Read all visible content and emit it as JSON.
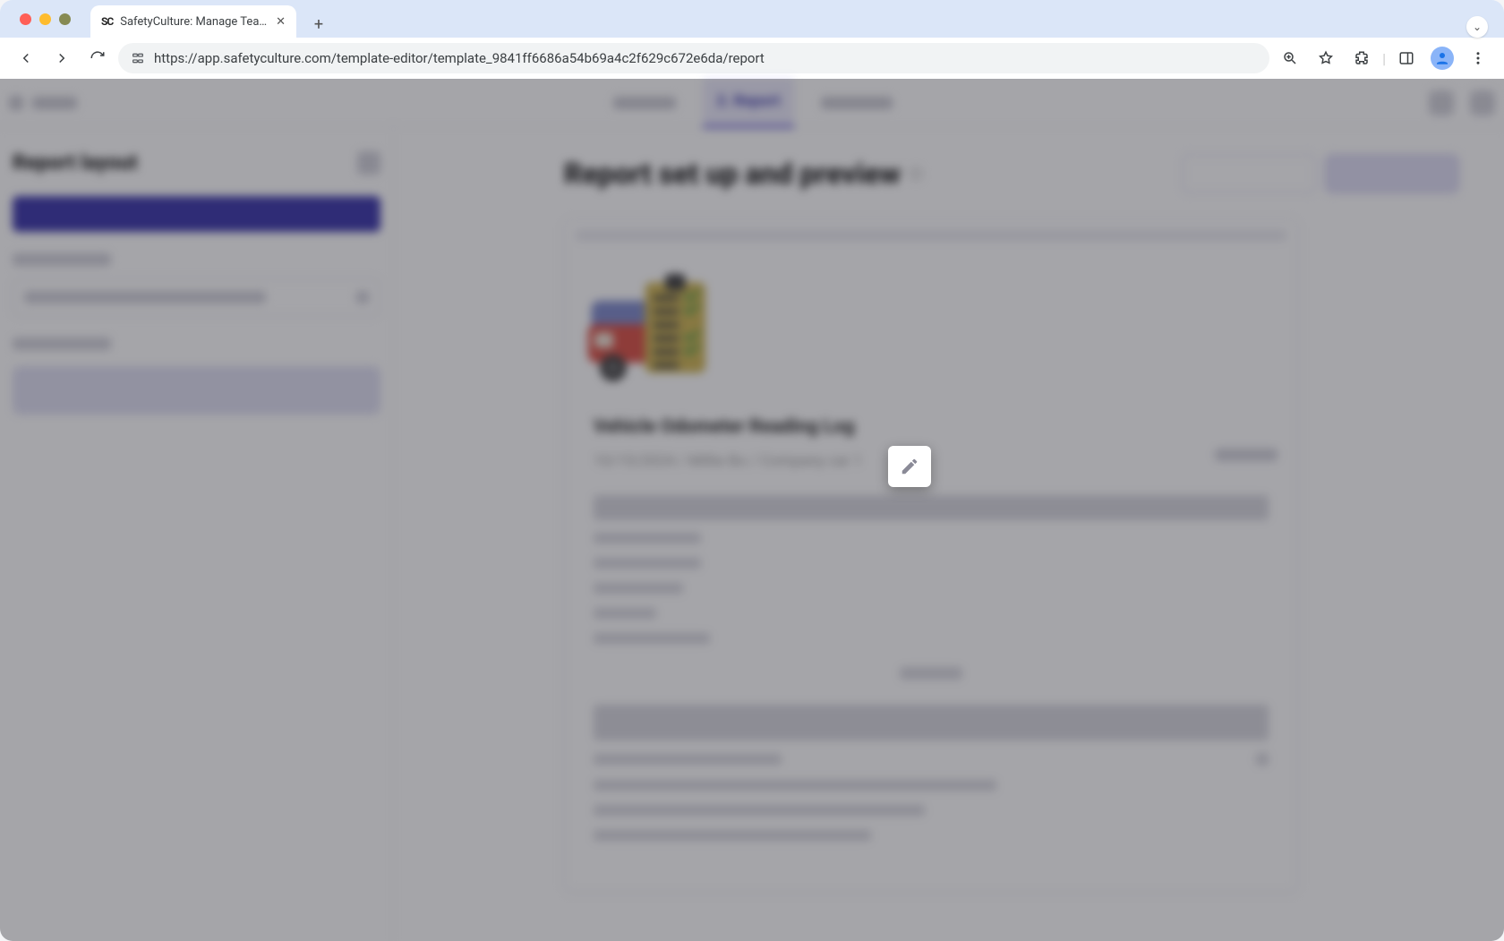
{
  "browser": {
    "tab_title": "SafetyCulture: Manage Teams and...",
    "url": "https://app.safetyculture.com/template-editor/template_9841ff6686a54b69a4c2f629c672e6da/report"
  },
  "header": {
    "active_step": "2. Report"
  },
  "sidebar": {
    "title": "Report layout"
  },
  "main": {
    "title": "Report set up and preview"
  },
  "report": {
    "title": "Vehicle Odometer Reading Log",
    "subtitle": "10/15/2024 / Millie Bo / Company car 1"
  }
}
